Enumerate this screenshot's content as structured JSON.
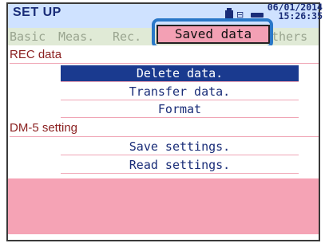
{
  "header": {
    "title": "SET UP",
    "date": "06/01/2014",
    "time": "15:26:35"
  },
  "tabs": [
    {
      "label": "Basic",
      "active": false
    },
    {
      "label": "Meas.",
      "active": false
    },
    {
      "label": "Rec.",
      "active": false
    },
    {
      "label": "Saved data",
      "active": true
    },
    {
      "label": "thers",
      "active": false
    }
  ],
  "sections": {
    "rec": {
      "title": "REC data",
      "items": [
        "Delete data.",
        "Transfer data.",
        "Format"
      ]
    },
    "dm5": {
      "title": "DM-5 setting",
      "items": [
        "Save settings.",
        "Read settings."
      ]
    }
  },
  "selected_item": "Delete data.",
  "icons": [
    "sd-card-icon",
    "usb-icon",
    "power-plug-icon"
  ],
  "colors": {
    "accent": "#1a3a8f",
    "active_tab": "#f3a0b4",
    "highlight_outline": "#2a78c8",
    "section_text": "#8a1f1f"
  }
}
